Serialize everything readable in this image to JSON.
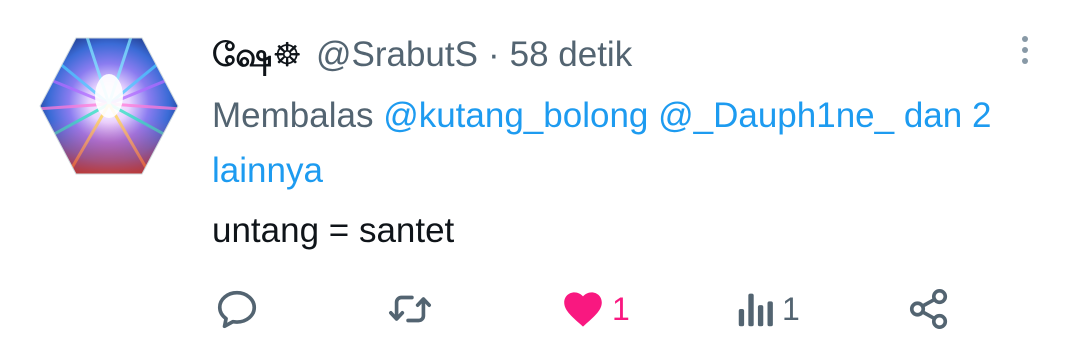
{
  "tweet": {
    "display_name": "ஷே☸",
    "handle": "@SrabutS",
    "separator": "·",
    "time": "58 detik",
    "reply_prefix": "Membalas",
    "mention_1": "@kutang_bolong",
    "mention_2": "@_Dauph1ne_",
    "reply_suffix": "dan 2 lainnya",
    "text": "untang = santet"
  },
  "actions": {
    "likes": "1",
    "views": "1"
  },
  "colors": {
    "text_primary": "#0f1419",
    "text_secondary": "#536471",
    "link": "#1d9bf0",
    "like": "#f91880"
  },
  "icons": [
    "avatar-image",
    "more-icon",
    "reply-icon",
    "retweet-icon",
    "heart-icon",
    "views-icon",
    "share-icon"
  ]
}
